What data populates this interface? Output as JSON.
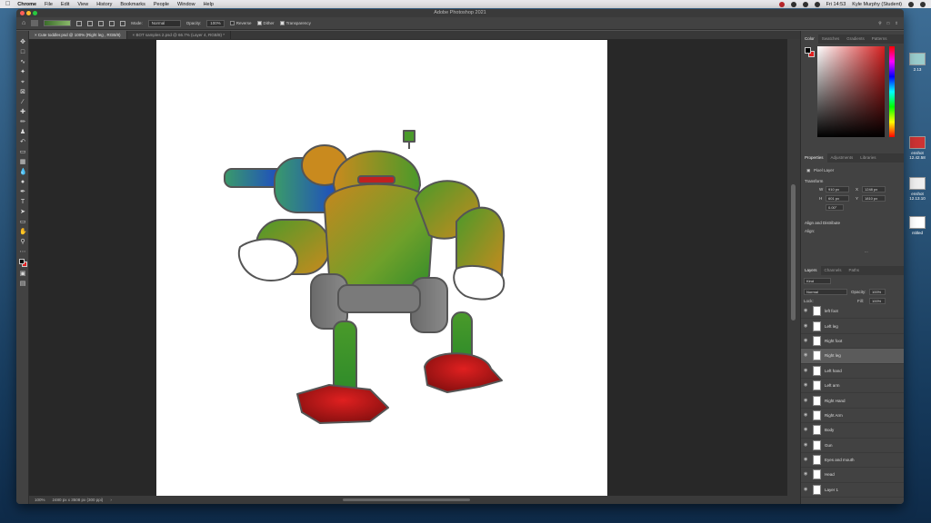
{
  "menubar": {
    "app_name": "Chrome",
    "items": [
      "File",
      "Edit",
      "View",
      "History",
      "Bookmarks",
      "People",
      "Window",
      "Help"
    ],
    "clock": "Fri 14:53",
    "user": "Kyle Murphy (Student)"
  },
  "desktop": {
    "icons": [
      {
        "label": "2.13"
      },
      {
        "label": "enshot 12.42.58"
      },
      {
        "label": "enshot 12.13.10"
      },
      {
        "label": "ntitled"
      }
    ]
  },
  "window": {
    "title": "Adobe Photoshop 2021"
  },
  "options": {
    "mode_label": "Mode:",
    "mode_value": "Normal",
    "opacity_label": "Opacity:",
    "opacity_value": "100%",
    "reverse": "Reverse",
    "dither": "Dither",
    "transparency": "Transparency"
  },
  "tabs": [
    {
      "label": "Cute toddler.psd @ 100% (Right leg , RGB/8)",
      "active": true
    },
    {
      "label": "BOT samples 2.psd @ 66.7% (Layer 4, RGB/8) *",
      "active": false
    }
  ],
  "status": {
    "zoom": "100%",
    "doc_size": "2480 px x 3508 px (300 ppi)"
  },
  "color_panel": {
    "tabs": [
      "Color",
      "Swatches",
      "Gradients",
      "Patterns"
    ],
    "active_tab": "Color",
    "foreground": "#000000",
    "background": "#e02020"
  },
  "properties_panel": {
    "tabs": [
      "Properties",
      "Adjustments",
      "Libraries"
    ],
    "active_tab": "Properties",
    "kind": "Pixel Layer",
    "transform_title": "Transform",
    "w_label": "W",
    "w_value": "910 px",
    "h_label": "H",
    "h_value": "601 px",
    "x_label": "X",
    "x_value": "1248 px",
    "y_label": "Y",
    "y_value": "1810 px",
    "angle_value": "0.00°",
    "align_title": "Align and Distribute",
    "align_label": "Align:",
    "more": "..."
  },
  "layers_panel": {
    "tabs": [
      "Layers",
      "Channels",
      "Paths"
    ],
    "active_tab": "Layers",
    "filter_kind": "Kind",
    "blend_mode": "Normal",
    "opacity_label": "Opacity:",
    "opacity_value": "100%",
    "lock_label": "Lock:",
    "fill_label": "Fill:",
    "fill_value": "100%",
    "layers": [
      {
        "name": "left foot",
        "selected": false
      },
      {
        "name": "Left leg",
        "selected": false
      },
      {
        "name": "Right foot",
        "selected": false
      },
      {
        "name": "Right leg",
        "selected": true
      },
      {
        "name": "Left hand",
        "selected": false
      },
      {
        "name": "Left arm",
        "selected": false
      },
      {
        "name": "Right Hand",
        "selected": false
      },
      {
        "name": "Right Arm",
        "selected": false
      },
      {
        "name": "Body",
        "selected": false
      },
      {
        "name": "Gun",
        "selected": false
      },
      {
        "name": "Eyes and mouth",
        "selected": false
      },
      {
        "name": "Head",
        "selected": false
      },
      {
        "name": "Layer 1",
        "selected": false
      }
    ]
  }
}
